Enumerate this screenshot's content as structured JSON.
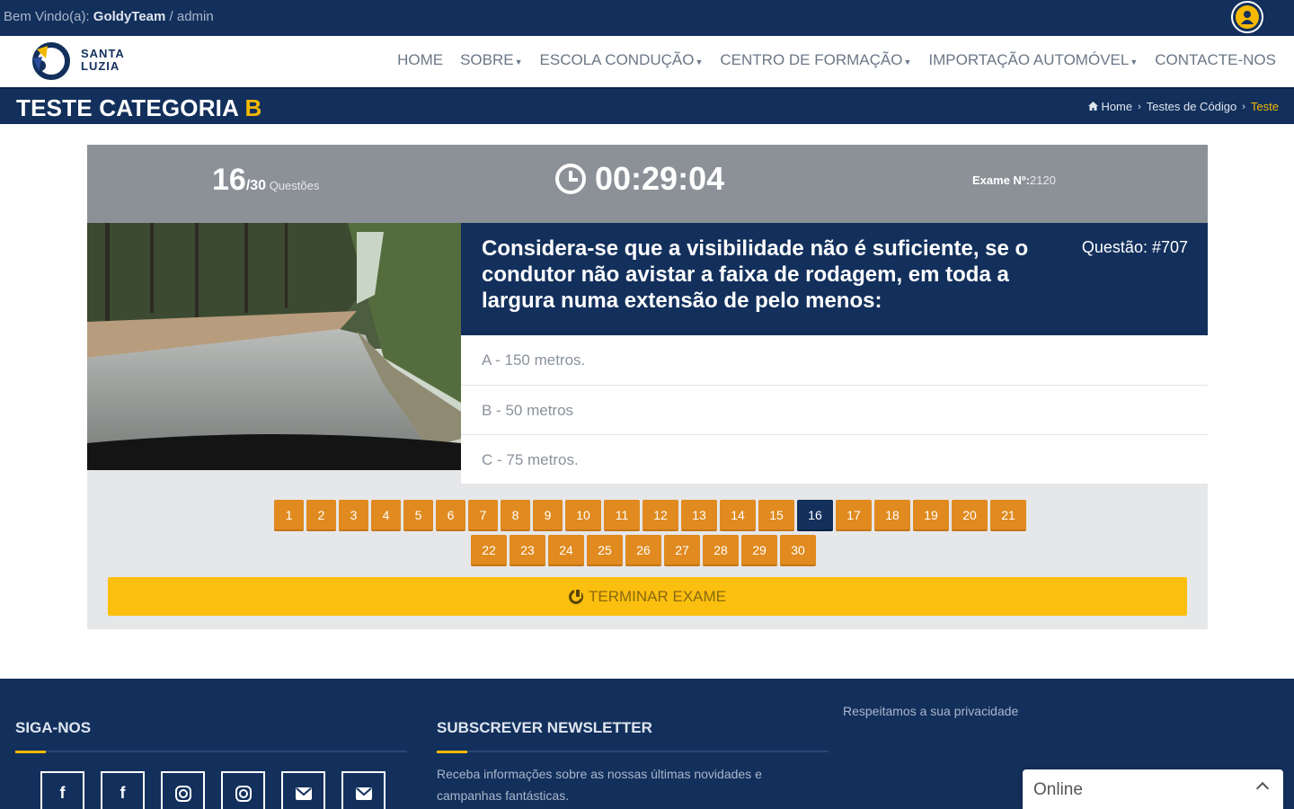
{
  "topbar": {
    "welcome_prefix": "Bem Vindo(a): ",
    "username": "GoldyTeam",
    "role": " / admin",
    "user_icon": "user-icon",
    "accent_color": "#f5b800"
  },
  "brand": {
    "line1": "SANTA",
    "line2": "LUZIA",
    "logo_icon": "santa-luzia-logo"
  },
  "nav": {
    "items": [
      {
        "label": "HOME",
        "dropdown": false
      },
      {
        "label": "SOBRE",
        "dropdown": true
      },
      {
        "label": "ESCOLA CONDUÇÃO",
        "dropdown": true
      },
      {
        "label": "CENTRO DE FORMAÇÃO",
        "dropdown": true
      },
      {
        "label": "IMPORTAÇÃO AUTOMÓVEL",
        "dropdown": true
      },
      {
        "label": "CONTACTE-NOS",
        "dropdown": false
      }
    ]
  },
  "page": {
    "title_main": "TESTE CATEGORIA ",
    "title_accent": "B",
    "breadcrumb": {
      "home": "Home",
      "section": "Testes de Código",
      "current": "Teste"
    }
  },
  "exam": {
    "current_question": "16",
    "total_questions": "/30",
    "questions_label": " Questões",
    "timer": "00:29:04",
    "exam_number_label": "Exame Nº:",
    "exam_number": "2120",
    "question_id": "Questão: #707",
    "question_text": "Considera-se que a visibilidade não é suficiente, se o condutor não avistar a faixa de rodagem, em toda a largura numa extensão de pelo menos:",
    "answers": [
      "A - 150 metros.",
      "B - 50 metros",
      "C - 75 metros."
    ],
    "pages_row1": [
      "1",
      "2",
      "3",
      "4",
      "5",
      "6",
      "7",
      "8",
      "9",
      "10",
      "11",
      "12",
      "13",
      "14",
      "15",
      "16",
      "17",
      "18",
      "19",
      "20",
      "21"
    ],
    "pages_row2": [
      "22",
      "23",
      "24",
      "25",
      "26",
      "27",
      "28",
      "29",
      "30"
    ],
    "active_page": "16",
    "finish_label": "TERMINAR EXAME",
    "finish_icon": "power-icon"
  },
  "footer": {
    "follow_title": "SIGA-NOS",
    "newsletter_title": "SUBSCREVER NEWSLETTER",
    "newsletter_desc": "Receba informações sobre as nossas últimas novidades e campanhas fantásticas.",
    "privacy": "Respeitamos a sua privacidade",
    "social_icons": [
      "facebook-icon",
      "facebook-icon",
      "instagram-icon",
      "instagram-icon",
      "email-icon",
      "email-icon"
    ]
  },
  "chat": {
    "status": "Online"
  }
}
